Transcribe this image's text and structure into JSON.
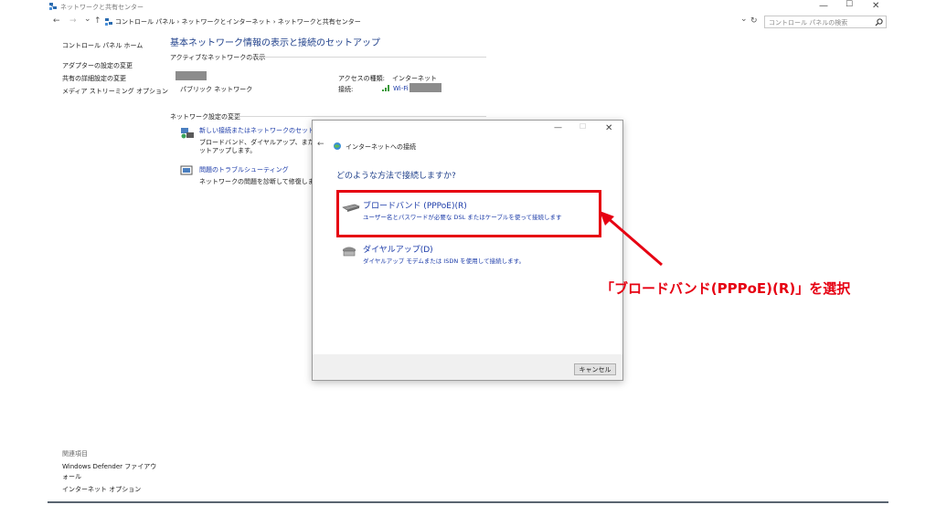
{
  "window": {
    "title": "ネットワークと共有センター",
    "minimize": "—",
    "maximize": "☐",
    "close": "✕"
  },
  "address": {
    "back": "←",
    "forward": "→",
    "dropdown": "⌄",
    "up": "↑",
    "breadcrumb": "コントロール パネル  ›  ネットワークとインターネット  ›  ネットワークと共有センター",
    "refresh": "↻",
    "search_placeholder": "コントロール パネルの検索",
    "search_icon": "search-icon"
  },
  "sidebar": {
    "home": "コントロール パネル ホーム",
    "items": [
      "アダプターの設定の変更",
      "共有の詳細設定の変更",
      "メディア ストリーミング オプション"
    ],
    "related_heading": "関連項目",
    "related": [
      "Windows Defender ファイアウォール",
      "インターネット オプション"
    ]
  },
  "main": {
    "title": "基本ネットワーク情報の表示と接続のセットアップ",
    "active_heading": "アクティブなネットワークの表示",
    "network_type": "パブリック ネットワーク",
    "access_label": "アクセスの種類:",
    "access_value": "インターネット",
    "conn_label": "接続:",
    "conn_value": "Wi-Fi",
    "change_heading": "ネットワーク設定の変更",
    "tasks": [
      {
        "title": "新しい接続またはネットワークのセットアップ",
        "desc1": "ブロードバンド、ダイヤルアップ、または VPN 接",
        "desc2": "ットアップします。"
      },
      {
        "title": "問題のトラブルシューティング",
        "desc1": "ネットワークの問題を診断して修復します。ま",
        "desc2": ""
      }
    ]
  },
  "dialog": {
    "title": "インターネットへの接続",
    "question": "どのような方法で接続しますか?",
    "options": [
      {
        "title": "ブロードバンド (PPPoE)(R)",
        "desc": "ユーザー名とパスワードが必要な DSL またはケーブルを使って接続します"
      },
      {
        "title": "ダイヤルアップ(D)",
        "desc": "ダイヤルアップ モデムまたは ISDN を使用して接続します。"
      }
    ],
    "cancel": "キャンセル"
  },
  "annotation": {
    "text": "「ブロードバンド(PPPoE)(R)」を選択",
    "color": "#e60012"
  }
}
